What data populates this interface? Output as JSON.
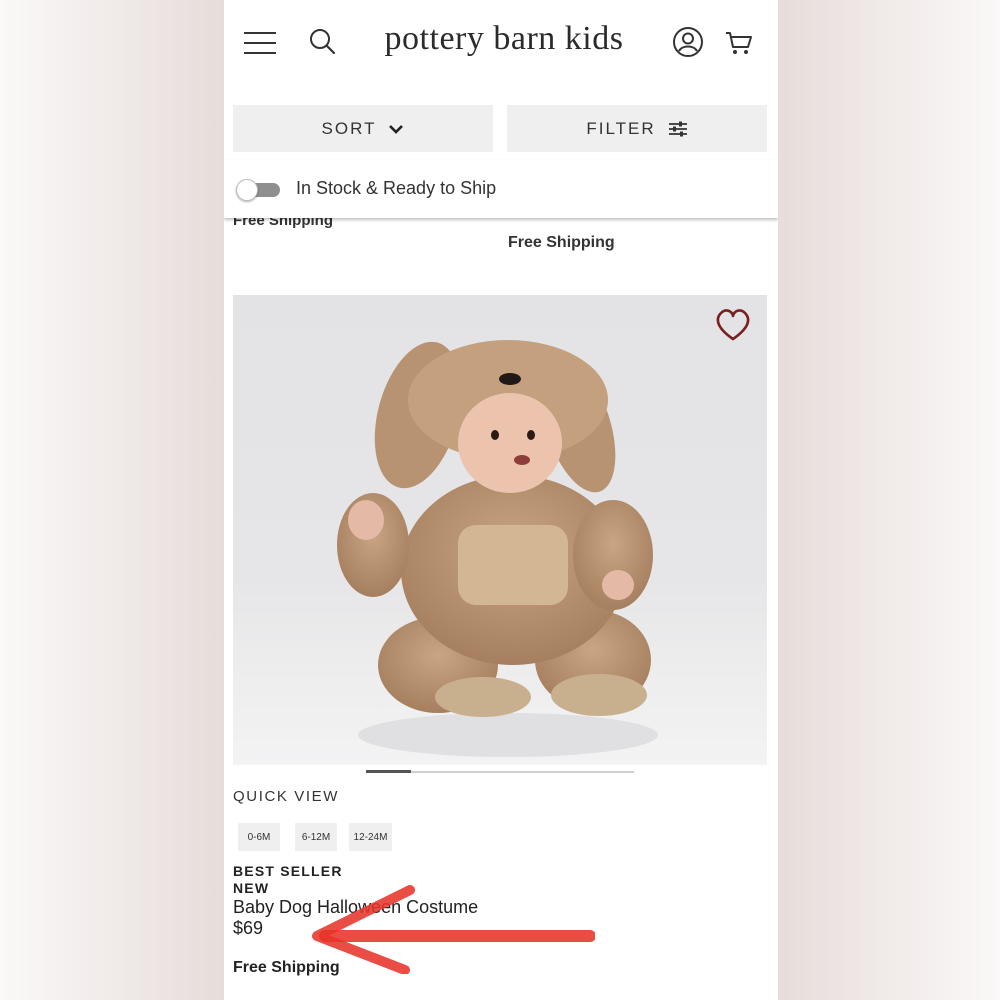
{
  "header": {
    "brand": "pottery barn kids"
  },
  "toolbar": {
    "sort_label": "SORT",
    "filter_label": "FILTER"
  },
  "stock_toggle": {
    "label": "In Stock & Ready to Ship",
    "checked": false
  },
  "previous_row": {
    "left_shipping": "Free Shipping",
    "right_shipping": "Free Shipping"
  },
  "product": {
    "quick_view": "QUICK VIEW",
    "sizes": [
      "0-6M",
      "6-12M",
      "12-24M"
    ],
    "badges": [
      "BEST SELLER",
      "NEW"
    ],
    "name": "Baby Dog Halloween Costume",
    "price": "$69",
    "shipping": "Free Shipping",
    "favorite_color": "#7a1f1f",
    "image_slide": 1
  },
  "annotation": {
    "arrow_color": "#e6342a"
  }
}
